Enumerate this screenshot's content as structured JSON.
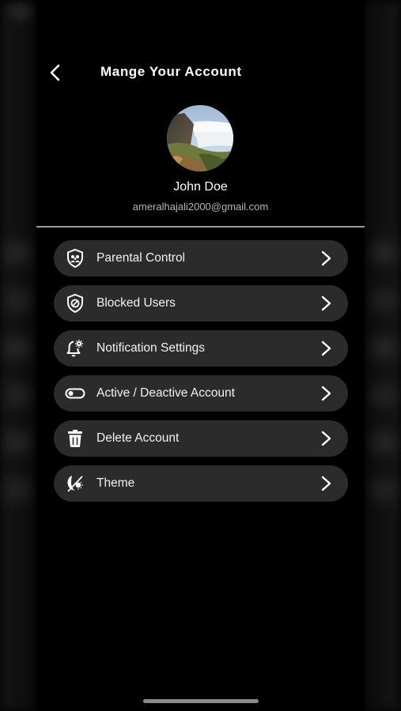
{
  "header": {
    "title": "Mange Your Account",
    "back_icon": "chevron-left-icon"
  },
  "profile": {
    "name": "John Doe",
    "email": "ameralhajali2000@gmail.com",
    "avatar_icon": "waterfall-photo"
  },
  "menu": {
    "items": [
      {
        "label": "Parental Control",
        "icon": "parental-shield-icon"
      },
      {
        "label": "Blocked Users",
        "icon": "blocked-shield-icon"
      },
      {
        "label": "Notification Settings",
        "icon": "bell-settings-icon"
      },
      {
        "label": "Active / Deactive Account",
        "icon": "toggle-icon"
      },
      {
        "label": "Delete Account",
        "icon": "trash-icon"
      },
      {
        "label": "Theme",
        "icon": "theme-icon"
      }
    ]
  },
  "colors": {
    "background": "#000000",
    "item_background": "#2b2b2b",
    "text": "#ffffff",
    "muted_text": "#b5b5b5",
    "divider": "#9a9a9a"
  }
}
